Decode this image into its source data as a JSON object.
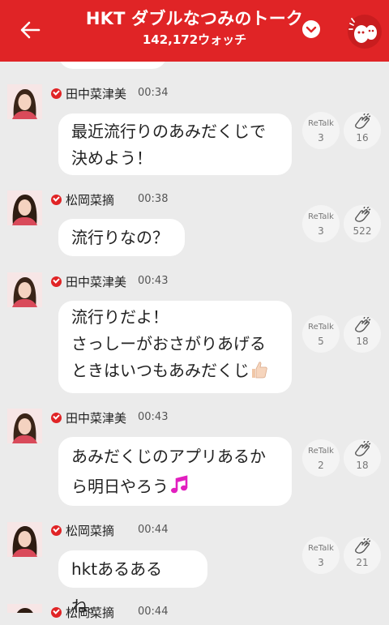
{
  "header": {
    "title": "HKT ダブルなつみのトーク",
    "watch_count": "142,172ウォッチ"
  },
  "icons": {
    "back": "arrow-left-icon",
    "dropdown": "chevron-down-icon",
    "mascot": "mascot-icon",
    "verified": "check-badge-icon",
    "clap": "clap-icon"
  },
  "colors": {
    "accent": "#e02426",
    "background": "#ebebeb",
    "bubble": "#ffffff"
  },
  "messages": [
    {
      "sender": "田中菜津美",
      "time": "00:34",
      "lines": [
        "最近流行りのあみだくじで",
        "決めよう！"
      ],
      "retalk_label": "ReTalk",
      "retalk": "3",
      "claps": "16"
    },
    {
      "sender": "松岡菜摘",
      "time": "00:38",
      "lines": [
        "流行りなの？"
      ],
      "retalk_label": "ReTalk",
      "retalk": "3",
      "claps": "522"
    },
    {
      "sender": "田中菜津美",
      "time": "00:43",
      "lines": [
        "流行りだよ！",
        "さっしーがおさがりあげる",
        "ときはいつもあみだくじ"
      ],
      "emoji": "thumbs-up-icon",
      "retalk_label": "ReTalk",
      "retalk": "5",
      "claps": "18"
    },
    {
      "sender": "田中菜津美",
      "time": "00:43",
      "lines": [
        "あみだくじのアプリあるか",
        "ら明日やろう"
      ],
      "emoji": "music-note-icon",
      "retalk_label": "ReTalk",
      "retalk": "2",
      "claps": "18"
    },
    {
      "sender": "松岡菜摘",
      "time": "00:44",
      "lines": [
        "hktあるあるね。"
      ],
      "retalk_label": "ReTalk",
      "retalk": "3",
      "claps": "21"
    },
    {
      "sender": "松岡菜摘",
      "time": "00:44"
    }
  ]
}
